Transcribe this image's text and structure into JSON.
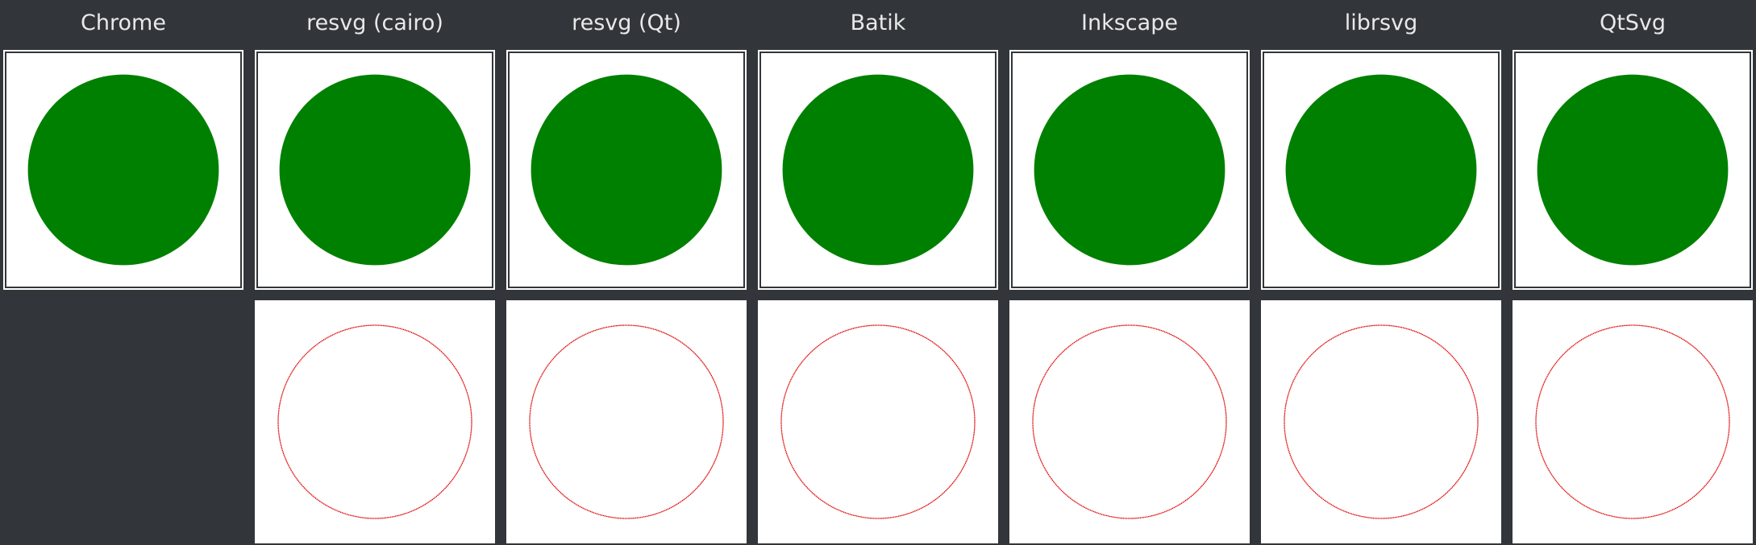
{
  "colors": {
    "background": "#32363a",
    "circle_fill": "#008000",
    "diff_stroke": "#e00000",
    "panel": "#ffffff",
    "title_text": "#e8e9ea"
  },
  "columns": [
    {
      "title": "Chrome",
      "has_diff": false
    },
    {
      "title": "resvg (cairo)",
      "has_diff": true
    },
    {
      "title": "resvg (Qt)",
      "has_diff": true
    },
    {
      "title": "Batik",
      "has_diff": true
    },
    {
      "title": "Inkscape",
      "has_diff": true
    },
    {
      "title": "librsvg",
      "has_diff": true
    },
    {
      "title": "QtSvg",
      "has_diff": true
    }
  ]
}
